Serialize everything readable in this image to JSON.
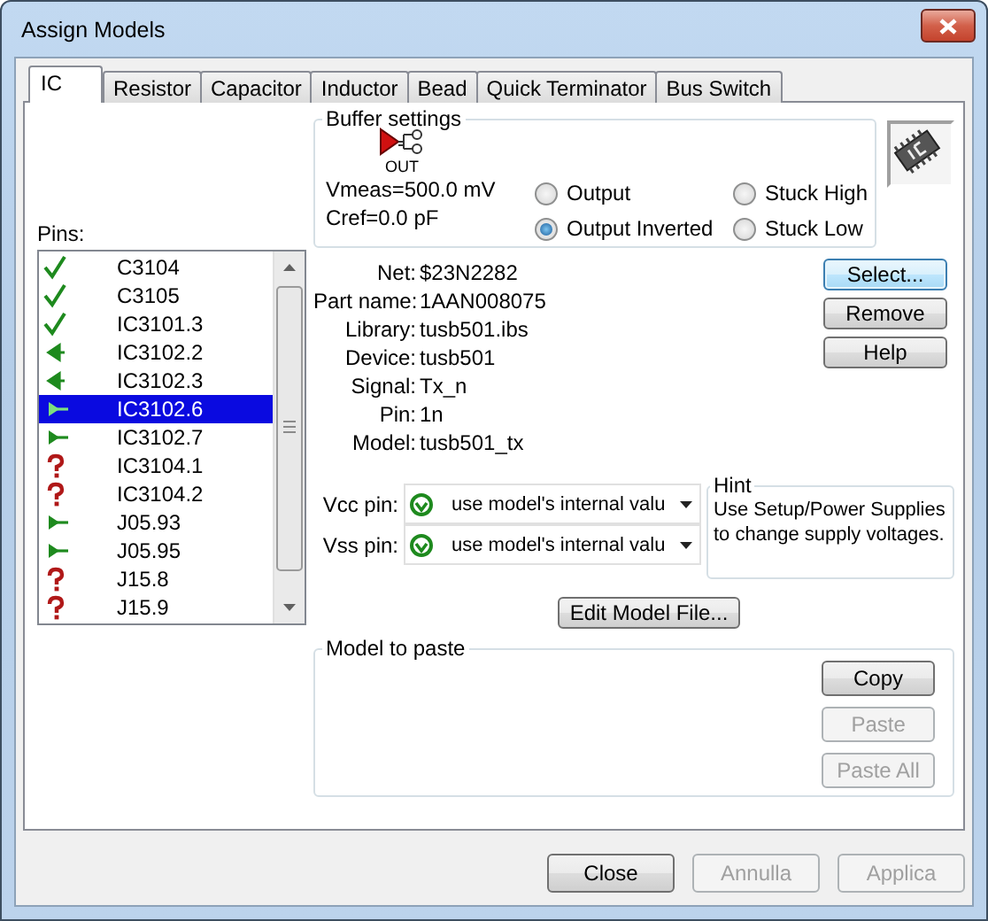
{
  "window": {
    "title": "Assign Models"
  },
  "tabs": [
    {
      "label": "IC",
      "selected": true
    },
    {
      "label": "Resistor",
      "selected": false
    },
    {
      "label": "Capacitor",
      "selected": false
    },
    {
      "label": "Inductor",
      "selected": false
    },
    {
      "label": "Bead",
      "selected": false
    },
    {
      "label": "Quick Terminator",
      "selected": false
    },
    {
      "label": "Bus Switch",
      "selected": false
    }
  ],
  "pins": {
    "label": "Pins:",
    "items": [
      {
        "name": "C3104",
        "kind": "check",
        "selected": false
      },
      {
        "name": "C3105",
        "kind": "check",
        "selected": false
      },
      {
        "name": "IC3101.3",
        "kind": "check",
        "selected": false
      },
      {
        "name": "IC3102.2",
        "kind": "input",
        "selected": false
      },
      {
        "name": "IC3102.3",
        "kind": "input",
        "selected": false
      },
      {
        "name": "IC3102.6",
        "kind": "output",
        "selected": true
      },
      {
        "name": "IC3102.7",
        "kind": "output",
        "selected": false
      },
      {
        "name": "IC3104.1",
        "kind": "unknown",
        "selected": false
      },
      {
        "name": "IC3104.2",
        "kind": "unknown",
        "selected": false
      },
      {
        "name": "J05.93",
        "kind": "output",
        "selected": false
      },
      {
        "name": "J05.95",
        "kind": "output",
        "selected": false
      },
      {
        "name": "J15.8",
        "kind": "unknown",
        "selected": false
      },
      {
        "name": "J15.9",
        "kind": "unknown",
        "selected": false
      }
    ]
  },
  "buffer_settings": {
    "title": "Buffer settings",
    "symbol_label": "OUT",
    "vmeas": "Vmeas=500.0 mV",
    "cref": "Cref=0.0 pF",
    "options": [
      {
        "label": "Output",
        "selected": false
      },
      {
        "label": "Output Inverted",
        "selected": true
      },
      {
        "label": "Stuck High",
        "selected": false
      },
      {
        "label": "Stuck Low",
        "selected": false
      }
    ]
  },
  "details": [
    {
      "label": "Net:",
      "value": "$23N2282"
    },
    {
      "label": "Part name:",
      "value": "1AAN008075"
    },
    {
      "label": "Library:",
      "value": "tusb501.ibs"
    },
    {
      "label": "Device:",
      "value": "tusb501"
    },
    {
      "label": "Signal:",
      "value": "Tx_n"
    },
    {
      "label": "Pin:",
      "value": "1n"
    },
    {
      "label": "Model:",
      "value": "tusb501_tx"
    }
  ],
  "side_buttons": [
    {
      "label": "Select...",
      "default": true
    },
    {
      "label": "Remove",
      "default": false
    },
    {
      "label": "Help",
      "default": false
    }
  ],
  "supply_pins": [
    {
      "label": "Vcc pin:",
      "value": "use model's internal valu"
    },
    {
      "label": "Vss pin:",
      "value": "use model's internal valu"
    }
  ],
  "hint": {
    "title": "Hint",
    "text": "Use Setup/Power Supplies to change supply voltages."
  },
  "edit_model_button": "Edit Model File...",
  "model_to_paste": {
    "title": "Model to paste",
    "buttons": [
      {
        "label": "Copy",
        "disabled": false
      },
      {
        "label": "Paste",
        "disabled": true
      },
      {
        "label": "Paste All",
        "disabled": true
      }
    ]
  },
  "footer_buttons": [
    {
      "label": "Close",
      "disabled": false
    },
    {
      "label": "Annulla",
      "disabled": true
    },
    {
      "label": "Applica",
      "disabled": true
    }
  ]
}
